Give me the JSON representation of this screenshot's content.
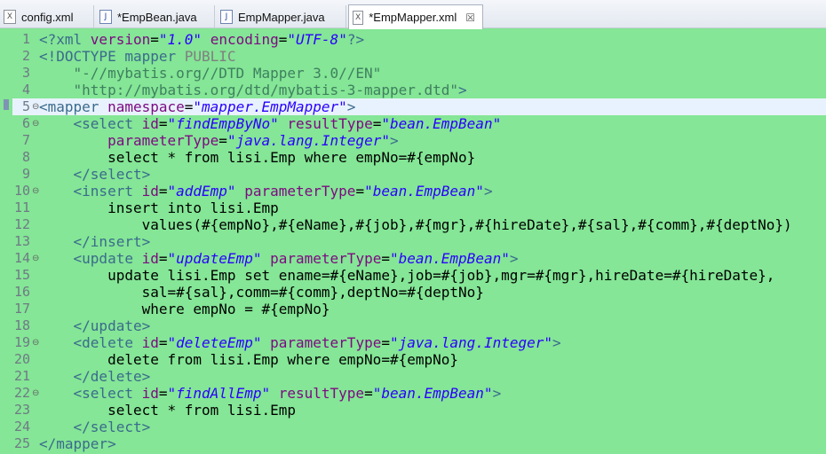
{
  "tabs": [
    {
      "label": "config.xml",
      "icon": "xml-file-icon",
      "glyph": "X",
      "active": false
    },
    {
      "label": "*EmpBean.java",
      "icon": "java-file-icon",
      "glyph": "J",
      "active": false
    },
    {
      "label": "EmpMapper.java",
      "icon": "java-file-icon",
      "glyph": "J",
      "active": false
    },
    {
      "label": "*EmpMapper.xml",
      "icon": "xml-file-icon",
      "glyph": "X",
      "active": true,
      "close": "☒"
    }
  ],
  "editor": {
    "background": "#84e696",
    "current_line": 5,
    "lines": [
      {
        "n": "1",
        "fold": "",
        "tokens": [
          [
            "t-pi",
            "<?xml "
          ],
          [
            "t-attr",
            "version"
          ],
          [
            "t-text",
            "="
          ],
          [
            "t-val",
            "\"1.0\""
          ],
          [
            "t-text",
            " "
          ],
          [
            "t-attr",
            "encoding"
          ],
          [
            "t-text",
            "="
          ],
          [
            "t-val",
            "\"UTF-8\""
          ],
          [
            "t-pi",
            "?>"
          ]
        ]
      },
      {
        "n": "2",
        "fold": "",
        "tokens": [
          [
            "t-doc",
            "<!DOCTYPE mapper "
          ],
          [
            "t-kw",
            "PUBLIC"
          ]
        ]
      },
      {
        "n": "3",
        "fold": "",
        "tokens": [
          [
            "t-text",
            "    "
          ],
          [
            "t-str",
            "\"-//mybatis.org//DTD Mapper 3.0//EN\""
          ]
        ]
      },
      {
        "n": "4",
        "fold": "",
        "tokens": [
          [
            "t-text",
            "    "
          ],
          [
            "t-str",
            "\"http://mybatis.org/dtd/mybatis-3-mapper.dtd\""
          ],
          [
            "t-doc",
            ">"
          ]
        ]
      },
      {
        "n": "5",
        "fold": "⊖",
        "tokens": [
          [
            "t-tag",
            "<mapper "
          ],
          [
            "t-attr",
            "namespace"
          ],
          [
            "t-text",
            "="
          ],
          [
            "t-val",
            "\"mapper.EmpMapper\""
          ],
          [
            "t-tag",
            ">"
          ]
        ]
      },
      {
        "n": "6",
        "fold": "⊖",
        "tokens": [
          [
            "t-text",
            "    "
          ],
          [
            "t-tag",
            "<select "
          ],
          [
            "t-attr",
            "id"
          ],
          [
            "t-text",
            "="
          ],
          [
            "t-val",
            "\"findEmpByNo\""
          ],
          [
            "t-text",
            " "
          ],
          [
            "t-attr",
            "resultType"
          ],
          [
            "t-text",
            "="
          ],
          [
            "t-val",
            "\"bean.EmpBean\""
          ]
        ]
      },
      {
        "n": "7",
        "fold": "",
        "tokens": [
          [
            "t-text",
            "        "
          ],
          [
            "t-attr",
            "parameterType"
          ],
          [
            "t-text",
            "="
          ],
          [
            "t-val",
            "\"java.lang.Integer\""
          ],
          [
            "t-tag",
            ">"
          ]
        ]
      },
      {
        "n": "8",
        "fold": "",
        "tokens": [
          [
            "t-text",
            "        select * from lisi.Emp where empNo=#{empNo}"
          ]
        ]
      },
      {
        "n": "9",
        "fold": "",
        "tokens": [
          [
            "t-text",
            "    "
          ],
          [
            "t-tag",
            "</select>"
          ]
        ]
      },
      {
        "n": "10",
        "fold": "⊖",
        "tokens": [
          [
            "t-text",
            "    "
          ],
          [
            "t-tag",
            "<insert "
          ],
          [
            "t-attr",
            "id"
          ],
          [
            "t-text",
            "="
          ],
          [
            "t-val",
            "\"addEmp\""
          ],
          [
            "t-text",
            " "
          ],
          [
            "t-attr",
            "parameterType"
          ],
          [
            "t-text",
            "="
          ],
          [
            "t-val",
            "\"bean.EmpBean\""
          ],
          [
            "t-tag",
            ">"
          ]
        ]
      },
      {
        "n": "11",
        "fold": "",
        "tokens": [
          [
            "t-text",
            "        insert into lisi.Emp"
          ]
        ]
      },
      {
        "n": "12",
        "fold": "",
        "tokens": [
          [
            "t-text",
            "            values(#{empNo},#{eName},#{job},#{mgr},#{hireDate},#{sal},#{comm},#{deptNo})"
          ]
        ]
      },
      {
        "n": "13",
        "fold": "",
        "tokens": [
          [
            "t-text",
            "    "
          ],
          [
            "t-tag",
            "</insert>"
          ]
        ]
      },
      {
        "n": "14",
        "fold": "⊖",
        "tokens": [
          [
            "t-text",
            "    "
          ],
          [
            "t-tag",
            "<update "
          ],
          [
            "t-attr",
            "id"
          ],
          [
            "t-text",
            "="
          ],
          [
            "t-val",
            "\"updateEmp\""
          ],
          [
            "t-text",
            " "
          ],
          [
            "t-attr",
            "parameterType"
          ],
          [
            "t-text",
            "="
          ],
          [
            "t-val",
            "\"bean.EmpBean\""
          ],
          [
            "t-tag",
            ">"
          ]
        ]
      },
      {
        "n": "15",
        "fold": "",
        "tokens": [
          [
            "t-text",
            "        update lisi.Emp set ename=#{eName},job=#{job},mgr=#{mgr},hireDate=#{hireDate},"
          ]
        ]
      },
      {
        "n": "16",
        "fold": "",
        "tokens": [
          [
            "t-text",
            "            sal=#{sal},comm=#{comm},deptNo=#{deptNo}"
          ]
        ]
      },
      {
        "n": "17",
        "fold": "",
        "tokens": [
          [
            "t-text",
            "            where empNo = #{empNo}"
          ]
        ]
      },
      {
        "n": "18",
        "fold": "",
        "tokens": [
          [
            "t-text",
            "    "
          ],
          [
            "t-tag",
            "</update>"
          ]
        ]
      },
      {
        "n": "19",
        "fold": "⊖",
        "tokens": [
          [
            "t-text",
            "    "
          ],
          [
            "t-tag",
            "<delete "
          ],
          [
            "t-attr",
            "id"
          ],
          [
            "t-text",
            "="
          ],
          [
            "t-val",
            "\"deleteEmp\""
          ],
          [
            "t-text",
            " "
          ],
          [
            "t-attr",
            "parameterType"
          ],
          [
            "t-text",
            "="
          ],
          [
            "t-val",
            "\"java.lang.Integer\""
          ],
          [
            "t-tag",
            ">"
          ]
        ]
      },
      {
        "n": "20",
        "fold": "",
        "tokens": [
          [
            "t-text",
            "        delete from lisi.Emp where empNo=#{empNo}"
          ]
        ]
      },
      {
        "n": "21",
        "fold": "",
        "tokens": [
          [
            "t-text",
            "    "
          ],
          [
            "t-tag",
            "</delete>"
          ]
        ]
      },
      {
        "n": "22",
        "fold": "⊖",
        "tokens": [
          [
            "t-text",
            "    "
          ],
          [
            "t-tag",
            "<select "
          ],
          [
            "t-attr",
            "id"
          ],
          [
            "t-text",
            "="
          ],
          [
            "t-val",
            "\"findAllEmp\""
          ],
          [
            "t-text",
            " "
          ],
          [
            "t-attr",
            "resultType"
          ],
          [
            "t-text",
            "="
          ],
          [
            "t-val",
            "\"bean.EmpBean\""
          ],
          [
            "t-tag",
            ">"
          ]
        ]
      },
      {
        "n": "23",
        "fold": "",
        "tokens": [
          [
            "t-text",
            "        select * from lisi.Emp"
          ]
        ]
      },
      {
        "n": "24",
        "fold": "",
        "tokens": [
          [
            "t-text",
            "    "
          ],
          [
            "t-tag",
            "</select>"
          ]
        ]
      },
      {
        "n": "25",
        "fold": "",
        "tokens": [
          [
            "t-tag",
            "</mapper>"
          ]
        ]
      }
    ]
  }
}
